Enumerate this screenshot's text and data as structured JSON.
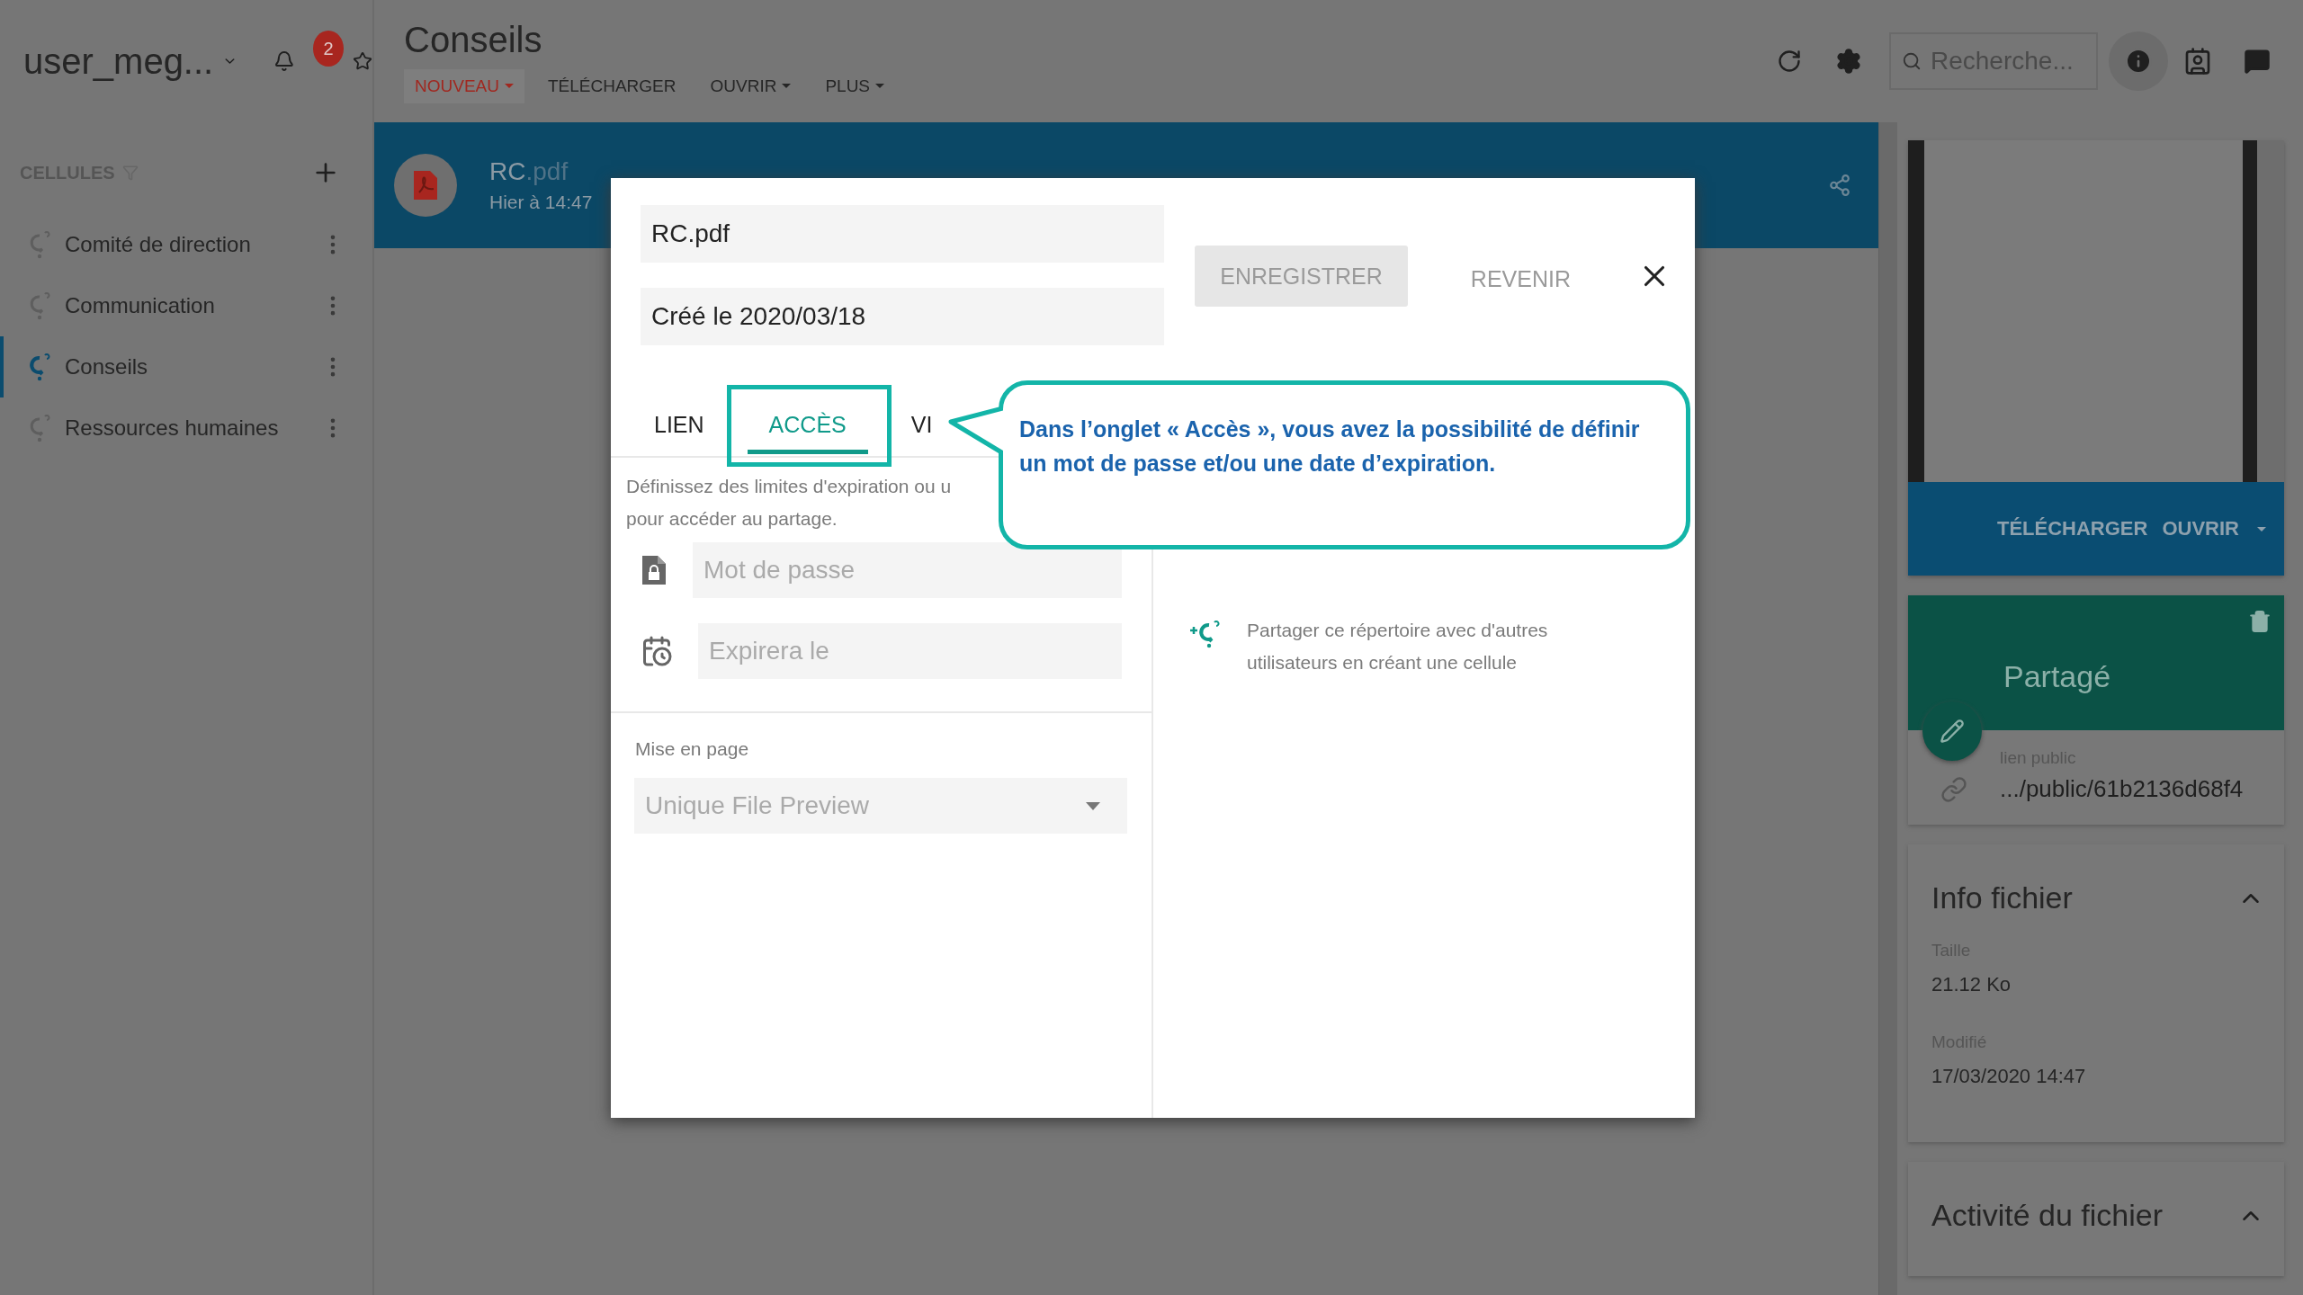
{
  "user": {
    "name": "user_meg...",
    "notifications": "2"
  },
  "sidebar": {
    "heading": "CELLULES",
    "items": [
      {
        "label": "Comité de direction",
        "selected": false
      },
      {
        "label": "Communication",
        "selected": false
      },
      {
        "label": "Conseils",
        "selected": true
      },
      {
        "label": "Ressources humaines",
        "selected": false
      }
    ]
  },
  "header": {
    "title": "Conseils",
    "actions": [
      {
        "label": "NOUVEAU",
        "kind": "primary",
        "dropdown": true
      },
      {
        "label": "TÉLÉCHARGER",
        "kind": "plain",
        "dropdown": false
      },
      {
        "label": "OUVRIR",
        "kind": "plain",
        "dropdown": true
      },
      {
        "label": "PLUS",
        "kind": "plain",
        "dropdown": true
      }
    ],
    "search": {
      "placeholder": "Recherche..."
    }
  },
  "file": {
    "name": "RC",
    "extension": ".pdf",
    "meta": "Hier à 14:47"
  },
  "dialog": {
    "name_value": "RC.pdf",
    "created_value": "Créé le 2020/03/18",
    "buttons": [
      {
        "label": "ENREGISTRER",
        "kind": "filled"
      },
      {
        "label": "REVENIR",
        "kind": "text"
      }
    ],
    "tabs": [
      {
        "label": "LIEN",
        "selected": false
      },
      {
        "label": "ACCÈS",
        "selected": true
      },
      {
        "label": "VI",
        "selected": false
      }
    ],
    "description": [
      "Définissez des limites d'expiration ou u",
      "pour accéder au partage."
    ],
    "fields": [
      {
        "kind": "password",
        "placeholder": "Mot de passe"
      },
      {
        "kind": "date",
        "placeholder": "Expirera le"
      }
    ],
    "layout": {
      "label": "Mise en page",
      "value": "Unique File Preview"
    },
    "cell_hint": [
      "Partager ce répertoire avec d'autres",
      "utilisateurs en créant une cellule"
    ]
  },
  "callout": {
    "lines": [
      "Dans l’onglet « Accès », vous avez la possibilité de définir",
      "un mot de passe et/ou une date d’expiration."
    ]
  },
  "right_panel": {
    "preview_actions": [
      {
        "label": "TÉLÉCHARGER",
        "dropdown": false
      },
      {
        "label": "OUVRIR",
        "dropdown": true
      }
    ],
    "share": {
      "title": "Partagé",
      "link_label": "lien public",
      "link": ".../public/61b2136d68f4"
    },
    "info": {
      "title": "Info fichier",
      "expanded": true,
      "fields": [
        {
          "label": "Taille",
          "value": "21.12 Ko"
        },
        {
          "label": "Modifié",
          "value": "17/03/2020 14:47"
        }
      ]
    },
    "activity": {
      "title": "Activité du fichier",
      "expanded": true
    }
  }
}
